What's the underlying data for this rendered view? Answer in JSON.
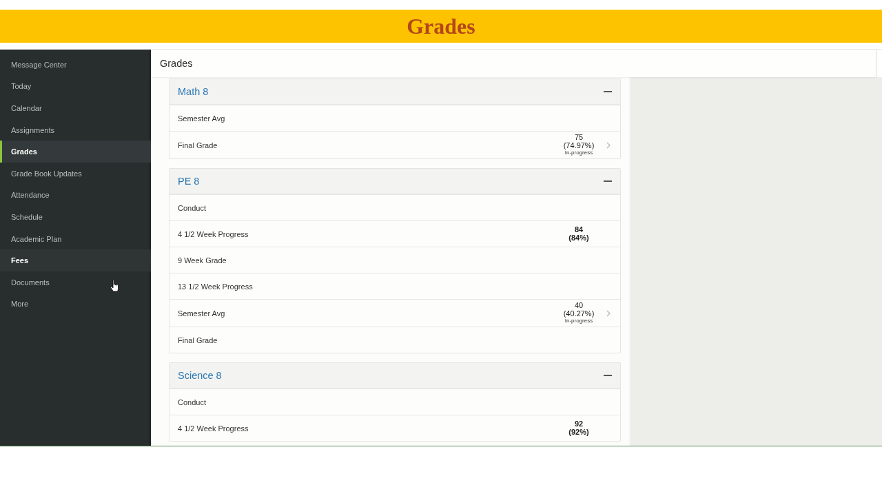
{
  "banner": {
    "title": "Grades"
  },
  "sidebar": {
    "items": [
      {
        "label": "Message Center",
        "selected": false,
        "highlighted": false
      },
      {
        "label": "Today",
        "selected": false,
        "highlighted": false
      },
      {
        "label": "Calendar",
        "selected": false,
        "highlighted": false
      },
      {
        "label": "Assignments",
        "selected": false,
        "highlighted": false
      },
      {
        "label": "Grades",
        "selected": true,
        "highlighted": false
      },
      {
        "label": "Grade Book Updates",
        "selected": false,
        "highlighted": false
      },
      {
        "label": "Attendance",
        "selected": false,
        "highlighted": false
      },
      {
        "label": "Schedule",
        "selected": false,
        "highlighted": false
      },
      {
        "label": "Academic Plan",
        "selected": false,
        "highlighted": false
      },
      {
        "label": "Fees",
        "selected": false,
        "highlighted": true
      },
      {
        "label": "Documents",
        "selected": false,
        "highlighted": false
      },
      {
        "label": "More",
        "selected": false,
        "highlighted": false
      }
    ]
  },
  "content": {
    "title": "Grades",
    "courses": [
      {
        "name": "Math 8",
        "expanded": true,
        "rows": [
          {
            "label": "Semester Avg"
          },
          {
            "label": "Final Grade",
            "grade": {
              "kind": "in_progress",
              "score": "75",
              "percent": "(74.97%)",
              "status": "In-progress"
            }
          }
        ]
      },
      {
        "name": "PE 8",
        "expanded": true,
        "rows": [
          {
            "label": "Conduct"
          },
          {
            "label": "4 1/2 Week Progress",
            "grade": {
              "kind": "posted",
              "score": "84",
              "percent": "(84%)"
            }
          },
          {
            "label": "9 Week Grade"
          },
          {
            "label": "13 1/2 Week Progress"
          },
          {
            "label": "Semester Avg",
            "grade": {
              "kind": "in_progress",
              "score": "40",
              "percent": "(40.27%)",
              "status": "In-progress"
            }
          },
          {
            "label": "Final Grade"
          }
        ]
      },
      {
        "name": "Science 8",
        "expanded": true,
        "rows": [
          {
            "label": "Conduct"
          },
          {
            "label": "4 1/2 Week Progress",
            "grade": {
              "kind": "posted",
              "score": "92",
              "percent": "(92%)"
            }
          }
        ]
      }
    ]
  }
}
